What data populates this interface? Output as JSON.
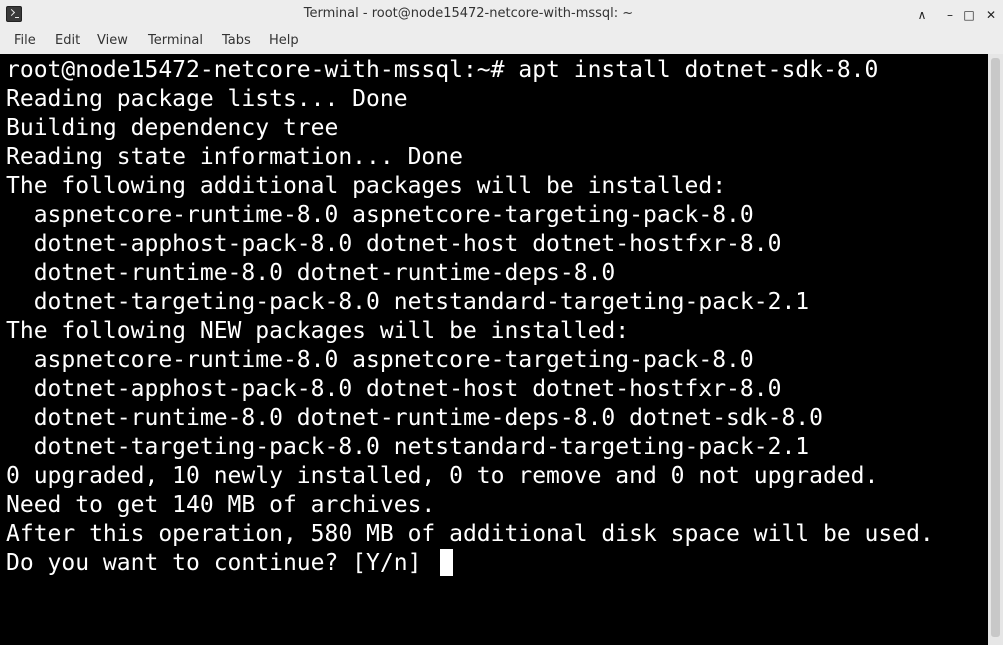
{
  "window": {
    "title": "Terminal - root@node15472-netcore-with-mssql: ~",
    "icon": "terminal-icon",
    "controls": {
      "minimize_shade": "∧",
      "minimize": "–",
      "maximize": "□",
      "close": "✕"
    }
  },
  "menubar": {
    "items": [
      "File",
      "Edit",
      "View",
      "Terminal",
      "Tabs",
      "Help"
    ]
  },
  "terminal": {
    "background": "#000000",
    "foreground": "#ffffff",
    "lines": [
      "root@node15472-netcore-with-mssql:~# apt install dotnet-sdk-8.0",
      "Reading package lists... Done",
      "Building dependency tree",
      "Reading state information... Done",
      "The following additional packages will be installed:",
      "  aspnetcore-runtime-8.0 aspnetcore-targeting-pack-8.0",
      "  dotnet-apphost-pack-8.0 dotnet-host dotnet-hostfxr-8.0",
      "  dotnet-runtime-8.0 dotnet-runtime-deps-8.0",
      "  dotnet-targeting-pack-8.0 netstandard-targeting-pack-2.1",
      "The following NEW packages will be installed:",
      "  aspnetcore-runtime-8.0 aspnetcore-targeting-pack-8.0",
      "  dotnet-apphost-pack-8.0 dotnet-host dotnet-hostfxr-8.0",
      "  dotnet-runtime-8.0 dotnet-runtime-deps-8.0 dotnet-sdk-8.0",
      "  dotnet-targeting-pack-8.0 netstandard-targeting-pack-2.1",
      "0 upgraded, 10 newly installed, 0 to remove and 0 not upgraded.",
      "Need to get 140 MB of archives.",
      "After this operation, 580 MB of additional disk space will be used.",
      "Do you want to continue? [Y/n] "
    ]
  }
}
